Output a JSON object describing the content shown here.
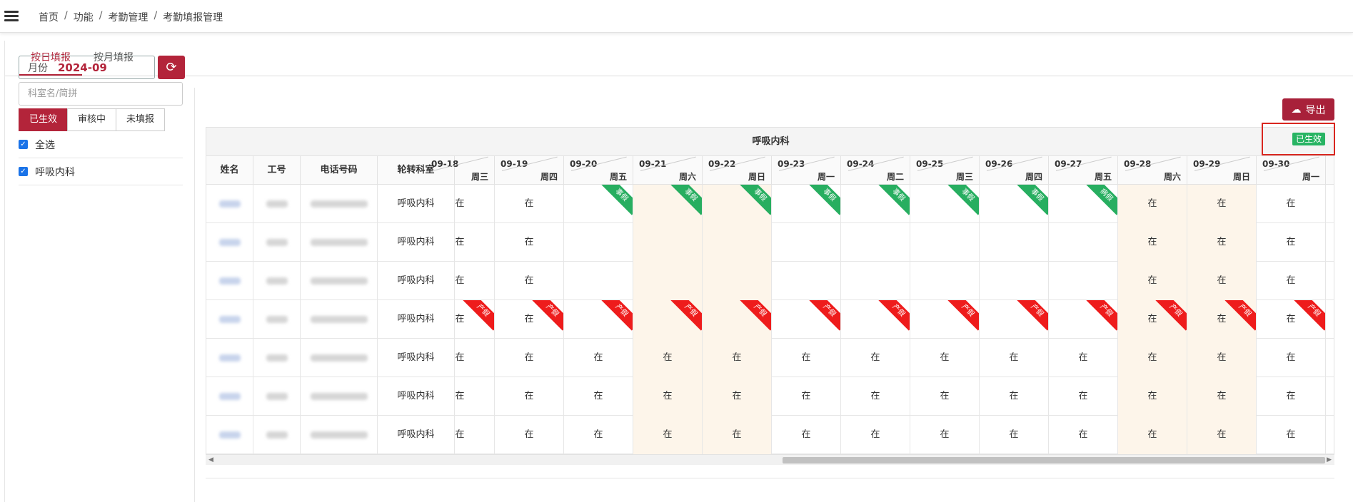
{
  "breadcrumb": [
    "首页",
    "功能",
    "考勤管理",
    "考勤填报管理"
  ],
  "tabs": [
    "按日填报",
    "按月填报"
  ],
  "side": {
    "month_label": "月份",
    "month_value": "2024-09",
    "search_placeholder": "科室名/简拼",
    "status_tabs": [
      "已生效",
      "审核中",
      "未填报"
    ],
    "checks": [
      "全选",
      "呼吸内科"
    ]
  },
  "export_label": "导出",
  "dept_title": "呼吸内科",
  "status_badge": "已生效",
  "columns": [
    "姓名",
    "工号",
    "电话号码",
    "轮转科室"
  ],
  "dates": [
    {
      "d": "09-18",
      "w": "周三"
    },
    {
      "d": "09-19",
      "w": "周四"
    },
    {
      "d": "09-20",
      "w": "周五"
    },
    {
      "d": "09-21",
      "w": "周六"
    },
    {
      "d": "09-22",
      "w": "周日"
    },
    {
      "d": "09-23",
      "w": "周一"
    },
    {
      "d": "09-24",
      "w": "周二"
    },
    {
      "d": "09-25",
      "w": "周三"
    },
    {
      "d": "09-26",
      "w": "周四"
    },
    {
      "d": "09-27",
      "w": "周五"
    },
    {
      "d": "09-28",
      "w": "周六"
    },
    {
      "d": "09-29",
      "w": "周日"
    },
    {
      "d": "09-30",
      "w": "周一"
    }
  ],
  "rows": [
    {
      "dept": "呼吸内科",
      "cells": [
        "在",
        "在",
        "",
        "",
        "",
        "",
        "",
        "",
        "",
        "",
        "在",
        "在",
        "在"
      ],
      "ribbons": [
        "",
        "",
        "事假",
        "事假",
        "事假",
        "事假",
        "事假",
        "事假",
        "事假",
        "病假",
        "",
        "",
        ""
      ],
      "ribbon_color": "green"
    },
    {
      "dept": "呼吸内科",
      "cells": [
        "在",
        "在",
        "",
        "",
        "",
        "",
        "",
        "",
        "",
        "",
        "在",
        "在",
        "在"
      ],
      "ribbons": [
        "",
        "",
        "",
        "",
        "",
        "",
        "",
        "",
        "",
        "",
        "",
        "",
        ""
      ],
      "ribbon_color": "green"
    },
    {
      "dept": "呼吸内科",
      "cells": [
        "在",
        "在",
        "",
        "",
        "",
        "",
        "",
        "",
        "",
        "",
        "在",
        "在",
        "在"
      ],
      "ribbons": [
        "",
        "",
        "",
        "",
        "",
        "",
        "",
        "",
        "",
        "",
        "",
        "",
        ""
      ],
      "ribbon_color": "green"
    },
    {
      "dept": "呼吸内科",
      "cells": [
        "在",
        "在",
        "",
        "",
        "",
        "",
        "",
        "",
        "",
        "",
        "在",
        "在",
        "在"
      ],
      "ribbons": [
        "产假",
        "产假",
        "产假",
        "产假",
        "产假",
        "产假",
        "产假",
        "产假",
        "产假",
        "产假",
        "产假",
        "产假",
        "产假"
      ],
      "ribbon_color": "red"
    },
    {
      "dept": "呼吸内科",
      "cells": [
        "在",
        "在",
        "在",
        "在",
        "在",
        "在",
        "在",
        "在",
        "在",
        "在",
        "在",
        "在",
        "在"
      ],
      "ribbons": [
        "",
        "",
        "",
        "",
        "",
        "",
        "",
        "",
        "",
        "",
        "",
        "",
        ""
      ],
      "ribbon_color": "green"
    },
    {
      "dept": "呼吸内科",
      "cells": [
        "在",
        "在",
        "在",
        "在",
        "在",
        "在",
        "在",
        "在",
        "在",
        "在",
        "在",
        "在",
        "在"
      ],
      "ribbons": [
        "",
        "",
        "",
        "",
        "",
        "",
        "",
        "",
        "",
        "",
        "",
        "",
        ""
      ],
      "ribbon_color": "green"
    },
    {
      "dept": "呼吸内科",
      "cells": [
        "在",
        "在",
        "在",
        "在",
        "在",
        "在",
        "在",
        "在",
        "在",
        "在",
        "在",
        "在",
        "在"
      ],
      "ribbons": [
        "",
        "",
        "",
        "",
        "",
        "",
        "",
        "",
        "",
        "",
        "",
        "",
        ""
      ],
      "ribbon_color": "green"
    }
  ]
}
